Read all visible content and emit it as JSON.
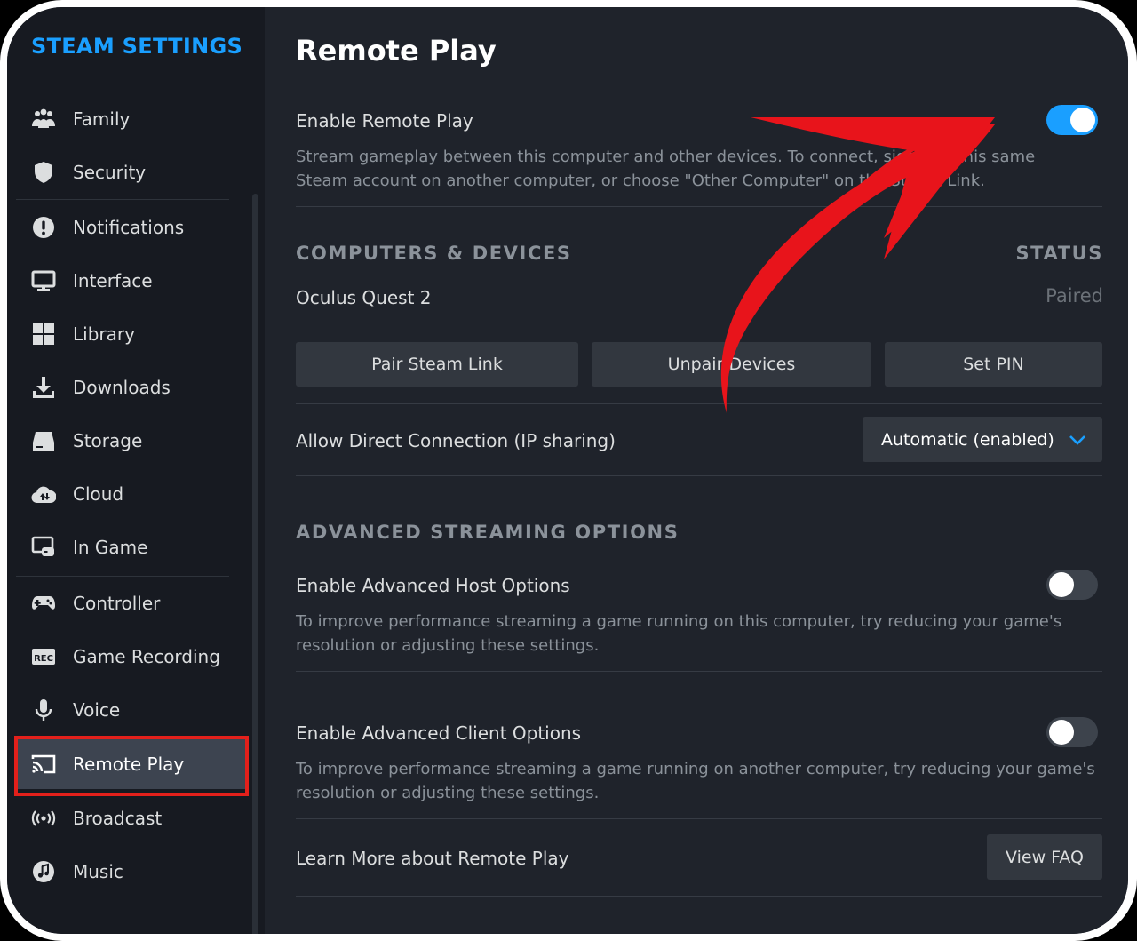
{
  "sidebar": {
    "title": "STEAM SETTINGS",
    "items": [
      {
        "label": "Family",
        "icon": "family-icon"
      },
      {
        "label": "Security",
        "icon": "shield-icon"
      },
      {
        "label": "Notifications",
        "icon": "alert-icon"
      },
      {
        "label": "Interface",
        "icon": "monitor-icon"
      },
      {
        "label": "Library",
        "icon": "grid-icon"
      },
      {
        "label": "Downloads",
        "icon": "download-icon"
      },
      {
        "label": "Storage",
        "icon": "drive-icon"
      },
      {
        "label": "Cloud",
        "icon": "cloud-icon"
      },
      {
        "label": "In Game",
        "icon": "in-game-icon"
      },
      {
        "label": "Controller",
        "icon": "gamepad-icon"
      },
      {
        "label": "Game Recording",
        "icon": "rec-icon"
      },
      {
        "label": "Voice",
        "icon": "microphone-icon"
      },
      {
        "label": "Remote Play",
        "icon": "cast-icon",
        "active": true
      },
      {
        "label": "Broadcast",
        "icon": "broadcast-icon"
      },
      {
        "label": "Music",
        "icon": "music-icon"
      }
    ]
  },
  "main": {
    "title": "Remote Play",
    "enable_remote_play": {
      "label": "Enable Remote Play",
      "description_line1": "Stream gameplay between this computer and other devices. To connect, sign into this same",
      "description_line2": "Steam account on another computer, or choose \"Other Computer\" on the Steam Link.",
      "enabled": true
    },
    "devices": {
      "heading": "COMPUTERS & DEVICES",
      "status_heading": "STATUS",
      "rows": [
        {
          "name": "Oculus Quest 2",
          "status": "Paired"
        }
      ],
      "buttons": {
        "pair": "Pair Steam Link",
        "unpair": "Unpair Devices",
        "pin": "Set PIN"
      }
    },
    "direct_connection": {
      "label": "Allow Direct Connection (IP sharing)",
      "value": "Automatic (enabled)"
    },
    "advanced": {
      "heading": "ADVANCED STREAMING OPTIONS",
      "host": {
        "label": "Enable Advanced Host Options",
        "description_line1": "To improve performance streaming a game running on this computer, try reducing your game's",
        "description_line2": "resolution or adjusting these settings.",
        "enabled": false
      },
      "client": {
        "label": "Enable Advanced Client Options",
        "description_line1": "To improve performance streaming a game running on another computer, try reducing your game's",
        "description_line2": "resolution or adjusting these settings.",
        "enabled": false
      }
    },
    "learn_more": {
      "label": "Learn More about Remote Play",
      "button": "View FAQ"
    }
  },
  "colors": {
    "accent": "#1a9fff",
    "highlight": "#e3201b",
    "arrow": "#e8141b"
  }
}
